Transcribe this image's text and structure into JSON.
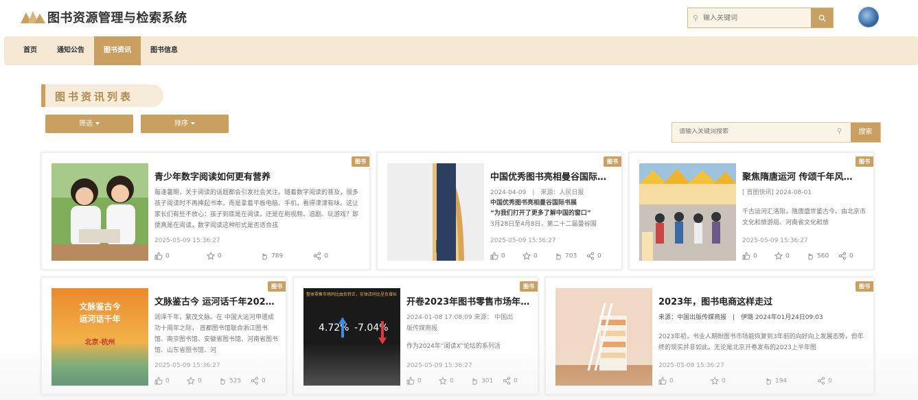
{
  "header": {
    "site_title": "图书资源管理与检索系统",
    "search_placeholder": "输入关键词"
  },
  "nav": {
    "items": [
      {
        "label": "首页"
      },
      {
        "label": "通知公告"
      },
      {
        "label": "图书资讯",
        "active": true
      },
      {
        "label": "图书信息"
      }
    ]
  },
  "section": {
    "title": "图书资讯列表"
  },
  "filters": {
    "filter_label": "筛选",
    "sort_label": "排序"
  },
  "list_search": {
    "placeholder": "请输入关键词搜索",
    "button_label": "搜索"
  },
  "colors": {
    "accent": "#c9a061",
    "nav_bg": "#f6e9d4",
    "search_bg": "#fbf3e5"
  },
  "cards": [
    {
      "tag": "图书",
      "title": "青少年数字阅读如何更有营养",
      "desc": "每逢暑期，关于阅读的话题都会引发社会关注。随着数字阅读的普及，很多孩子阅读时不再捧起书本，而是拿着平板电脑、手机，看得津津有味。这让家长们有些不放心：孩子到底是在阅读，还是在刷视频、追剧、玩游戏？即便真是在阅读，数字阅读这种形式是否适合孩",
      "time": "2025-05-09 15:36:27",
      "likes": "0",
      "favorites": "0",
      "clicks": "789",
      "shares": "0"
    },
    {
      "tag": "图书",
      "title": "中国优秀图书亮相曼谷国际...",
      "meta_line": "2024-04-09　|　来源：人民日报",
      "strong1": "中国优秀图书亮相曼谷国际书展",
      "strong2": "“为我们打开了更多了解中国的窗口”",
      "desc": "3月28日至4月8日，第二十二届曼谷国",
      "time": "2025-05-09 15:36:27",
      "likes": "0",
      "favorites": "0",
      "clicks": "703",
      "shares": "0"
    },
    {
      "tag": "图书",
      "title": "聚焦隋唐运河 传颂千年风雅...",
      "meta_line": "[ 首图快讯] 2024-08-01",
      "desc": "千古运河汇洛阳，隋唐盛世鉴古今。由北京市文化和旅游局、河南省文化和旅",
      "time": "2025-05-09 15:36:27",
      "likes": "0",
      "favorites": "0",
      "clicks": "560",
      "shares": "0"
    },
    {
      "tag": "图书",
      "title": "文脉鉴古今 运河话千年2024...",
      "desc": "润泽千年，繁茂文脉。在 中国大运河申遗成功十周年之际， 首都图书馆联合浙江图书馆、南京图书馆、安徽省图书馆、河南省图书馆、山东省图书馆、河",
      "time": "2025-05-09 15:36:27",
      "likes": "0",
      "favorites": "0",
      "clicks": "525",
      "shares": "0",
      "poster_line1": "文脉鉴古今",
      "poster_line2": "运河话千年",
      "poster_line3": "北京·杭州"
    },
    {
      "tag": "图书",
      "title": "开卷2023年图书零售市场年...",
      "meta_line": "2024-01-08 17:08:09 来源： 中国出版传媒商报",
      "desc": "作为2024年“阅读X”论坛的系列活",
      "time": "2025-05-09 15:36:27",
      "likes": "0",
      "favorites": "0",
      "clicks": "301",
      "shares": "0",
      "chart_caption": "整体零售市场同比由负转正，实体店同比呈负增长",
      "chart_left": "4.72%",
      "chart_right": "-7.04%"
    },
    {
      "tag": "图书",
      "title": "2023年，图书电商这样走过",
      "meta_line": "来源：中国出版传媒商报　|　伊璐 2024年01月24日09:03",
      "desc": "2023年初，书业人期盼图书市场能恢复到3年前的向好向上发展态势，但年终的现实并非如此。无论是北京开卷发布的2023上半年图",
      "time": "2025-05-09 15:36:27",
      "likes": "0",
      "favorites": "0",
      "clicks": "194",
      "shares": "0"
    }
  ]
}
